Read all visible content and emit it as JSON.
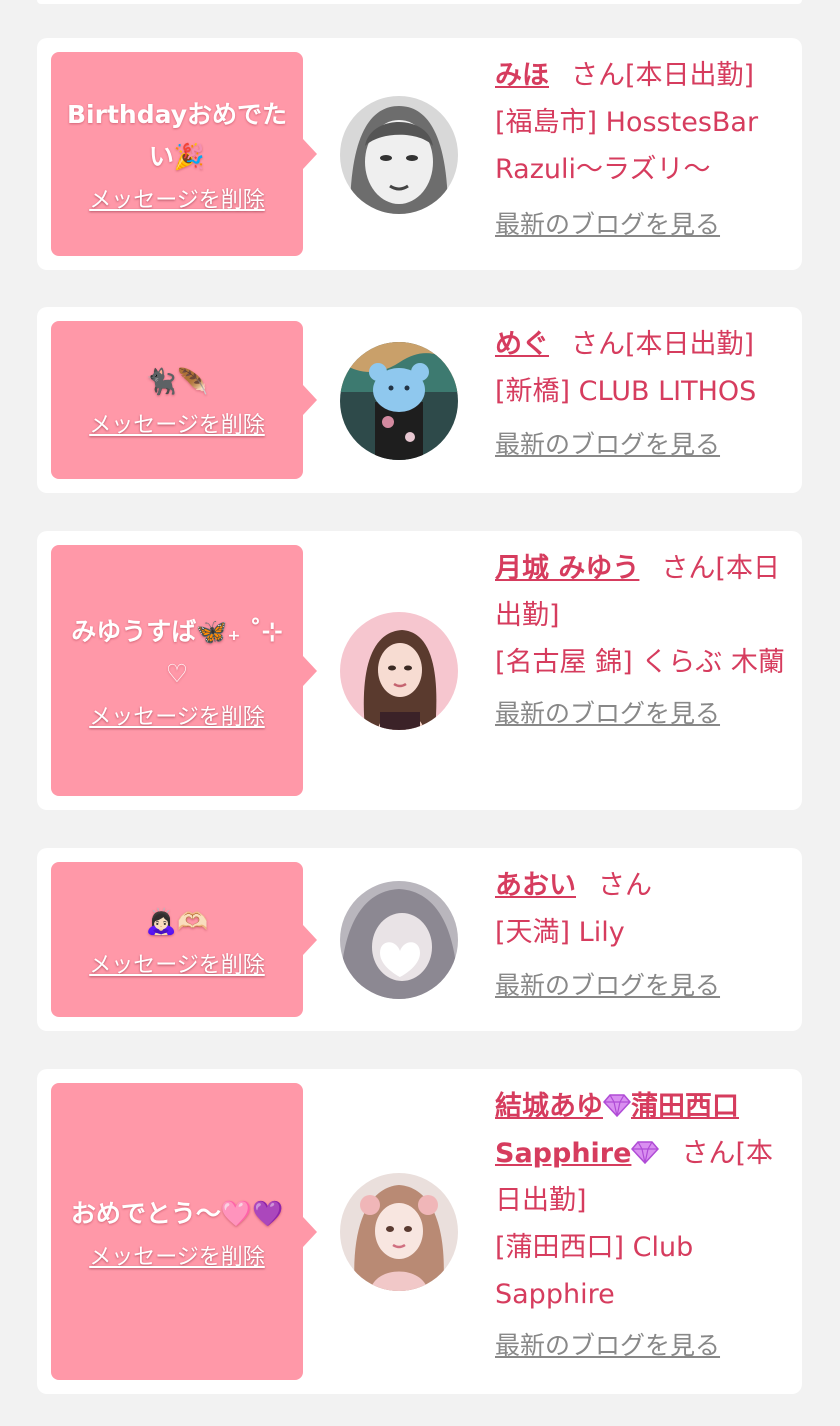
{
  "delete_label": "メッセージを削除",
  "san_label": "さん",
  "blog_label": "最新のブログを見る",
  "colors": {
    "accent": "#d63c5e",
    "bubble": "#ff98a8",
    "background": "#f2f2f2",
    "link_gray": "#888888"
  },
  "cards": [
    {
      "message": "Birthdayおめでたい🎉",
      "name": "みほ",
      "status": "[本日出勤]",
      "location": "[福島市]",
      "shop": "HosstesBar Razuli〜ラズリ〜"
    },
    {
      "message": "🐈‍⬛🪶",
      "name": "めぐ",
      "status": "[本日出勤]",
      "location": "[新橋]",
      "shop": "CLUB LITHOS"
    },
    {
      "message": "みゆうすば🦋₊ ˚⊹♡",
      "name": "月城 みゆう",
      "status": "[本日出勤]",
      "location": "[名古屋 錦]",
      "shop": "くらぶ 木蘭"
    },
    {
      "message": "🙇🏻‍♀️🫶🏻",
      "name": "あおい",
      "status": "",
      "location": "[天満]",
      "shop": "Lily"
    },
    {
      "message": "おめでとう〜🩷💜",
      "name_part1": "結城あゆ",
      "name_part2": "蒲田西口",
      "name_part3": "Sapphire",
      "status": "[本日出勤]",
      "location": "[蒲田西口]",
      "shop": "Club Sapphire"
    }
  ]
}
